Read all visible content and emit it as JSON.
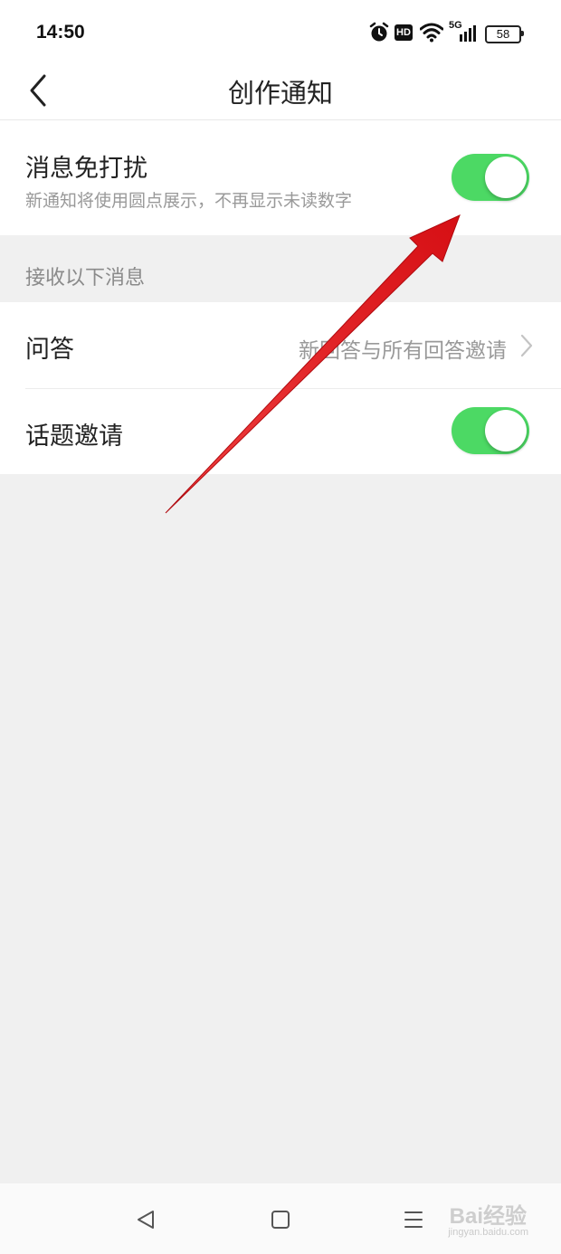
{
  "status_bar": {
    "time": "14:50",
    "icons": [
      "alarm-icon",
      "hd-icon",
      "wifi-icon",
      "5g-signal-icon",
      "battery-icon"
    ],
    "hd_label": "HD",
    "network_label": "5G",
    "battery": "58"
  },
  "header": {
    "title": "创作通知",
    "back_icon": "chevron-left-icon"
  },
  "dnd": {
    "title": "消息免打扰",
    "subtitle": "新通知将使用圆点展示，不再显示未读数字",
    "toggle_on": true
  },
  "section": {
    "header": "接收以下消息"
  },
  "list": {
    "items": [
      {
        "label": "问答",
        "value": "新回答与所有回答邀请",
        "type": "link"
      },
      {
        "label": "话题邀请",
        "type": "toggle",
        "toggle_on": true
      }
    ]
  },
  "system_nav": {
    "icons": [
      "back-triangle-icon",
      "home-square-icon",
      "menu-lines-icon"
    ]
  },
  "watermark": {
    "brand": "Bai经验",
    "url": "jingyan.baidu.com"
  },
  "colors": {
    "toggle_on": "#4cd964",
    "annotation_arrow": "#e8141c",
    "background": "#f0f0f0"
  }
}
